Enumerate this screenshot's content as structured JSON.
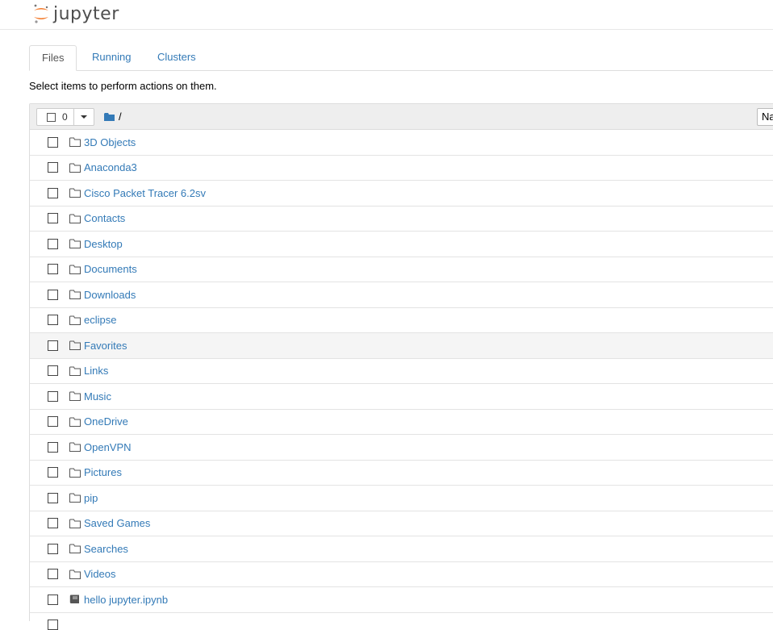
{
  "app": {
    "logo_text": "jupyter"
  },
  "tabs": [
    {
      "label": "Files",
      "active": true
    },
    {
      "label": "Running",
      "active": false
    },
    {
      "label": "Clusters",
      "active": false
    }
  ],
  "instructions": "Select items to perform actions on them.",
  "list_header": {
    "selected_count": "0",
    "path": "/",
    "sort_label": "Na"
  },
  "items": [
    {
      "name": "3D Objects",
      "type": "folder"
    },
    {
      "name": "Anaconda3",
      "type": "folder"
    },
    {
      "name": "Cisco Packet Tracer 6.2sv",
      "type": "folder"
    },
    {
      "name": "Contacts",
      "type": "folder"
    },
    {
      "name": "Desktop",
      "type": "folder"
    },
    {
      "name": "Documents",
      "type": "folder"
    },
    {
      "name": "Downloads",
      "type": "folder"
    },
    {
      "name": "eclipse",
      "type": "folder"
    },
    {
      "name": "Favorites",
      "type": "folder",
      "hover": true
    },
    {
      "name": "Links",
      "type": "folder"
    },
    {
      "name": "Music",
      "type": "folder"
    },
    {
      "name": "OneDrive",
      "type": "folder"
    },
    {
      "name": "OpenVPN",
      "type": "folder"
    },
    {
      "name": "Pictures",
      "type": "folder"
    },
    {
      "name": "pip",
      "type": "folder"
    },
    {
      "name": "Saved Games",
      "type": "folder"
    },
    {
      "name": "Searches",
      "type": "folder"
    },
    {
      "name": "Videos",
      "type": "folder"
    },
    {
      "name": "hello jupyter.ipynb",
      "type": "notebook"
    }
  ],
  "colors": {
    "link": "#337ab7",
    "logo_orange": "#f37726",
    "header_bg": "#eeeeee"
  }
}
